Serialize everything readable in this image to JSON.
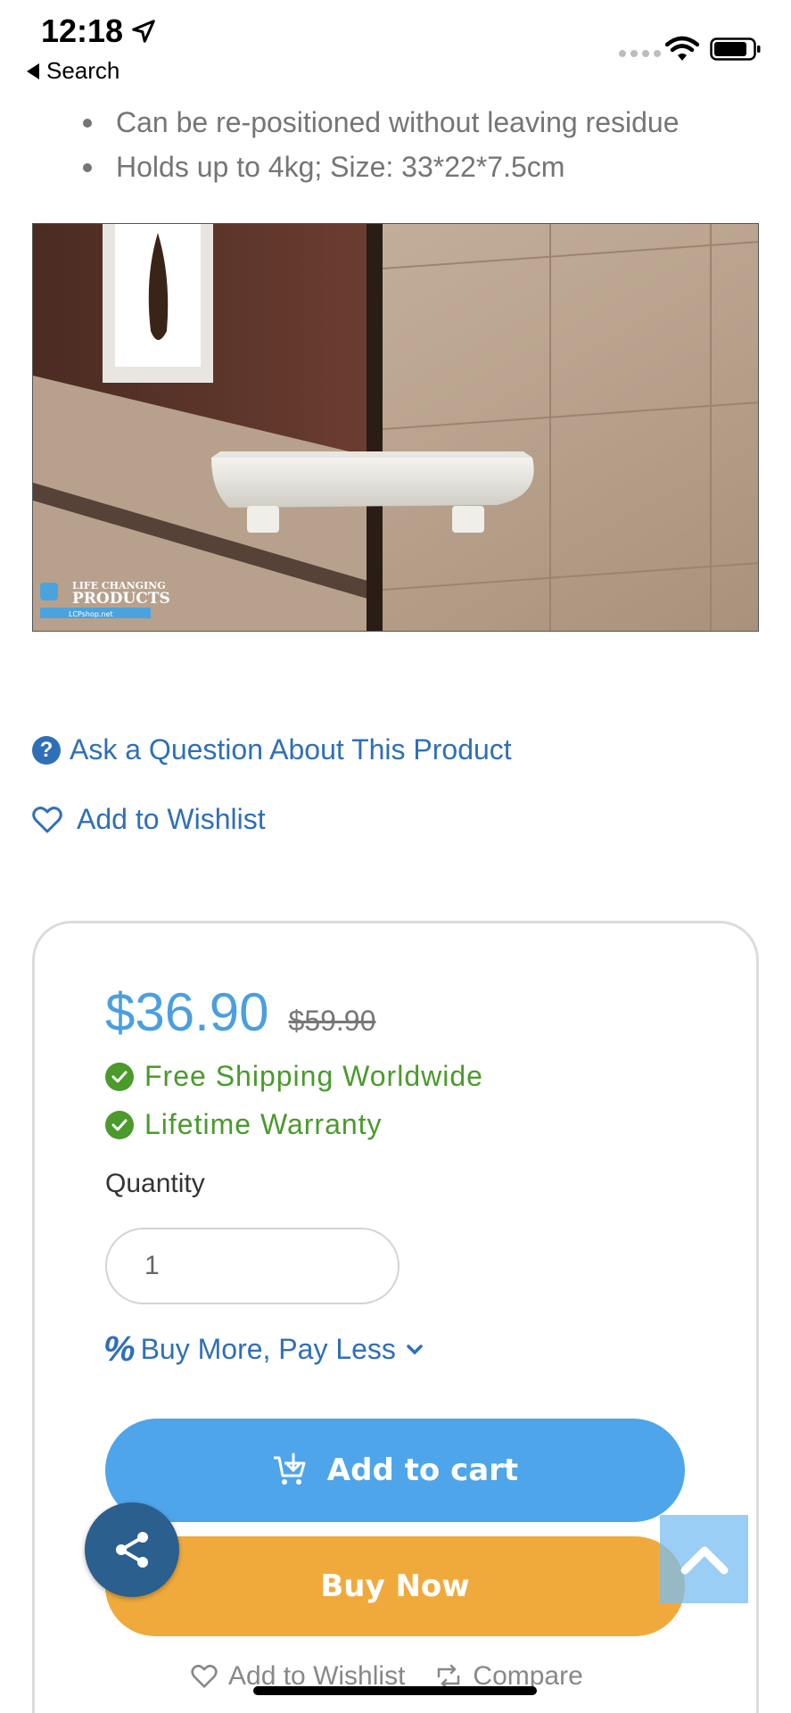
{
  "status_bar": {
    "time": "12:18",
    "back_label": "Search"
  },
  "bullets": [
    "Can be re-positioned without leaving residue",
    "Holds up to 4kg; Size: 33*22*7.5cm"
  ],
  "product_image": {
    "logo_text_1": "LIFE CHANGING",
    "logo_text_2": "PRODUCTS",
    "logo_text_3": "LCPshop.net"
  },
  "links": {
    "ask_question": "Ask a Question About This Product",
    "add_to_wishlist": "Add to Wishlist"
  },
  "price_box": {
    "price_current": "$36.90",
    "price_old": "$59.90",
    "perks": [
      "Free Shipping Worldwide",
      "Lifetime Warranty"
    ],
    "quantity_label": "Quantity",
    "quantity_value": "1",
    "buy_more_label": "Buy More, Pay Less",
    "add_to_cart_label": "Add to cart",
    "buy_now_label": "Buy Now",
    "bottom_wishlist_label": "Add to Wishlist",
    "bottom_compare_label": "Compare"
  },
  "colors": {
    "link_blue": "#2f6fb8",
    "price_blue": "#4a9fe0",
    "perk_green": "#4a9a2c",
    "cart_button": "#4ea5ea",
    "buy_button": "#f0aa3c",
    "share_fab": "#2a5f8e"
  }
}
